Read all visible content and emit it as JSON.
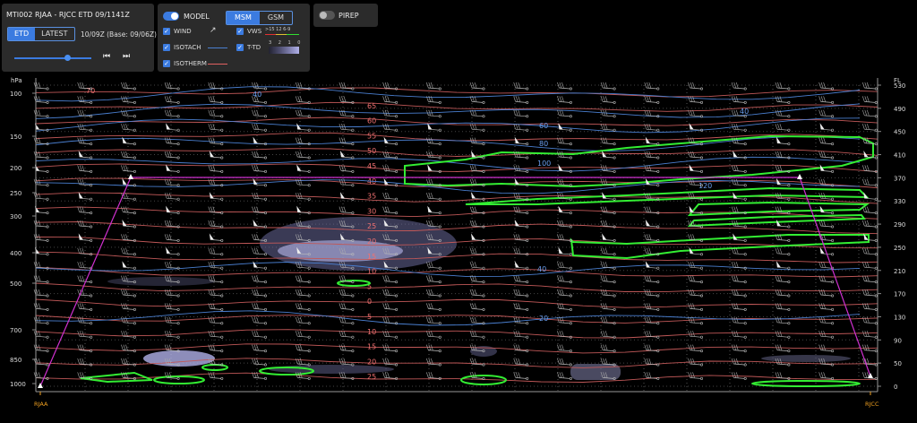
{
  "flight": {
    "route": "MTI002 RJAA - RJCC  ETD 09/1141Z",
    "mode_options": [
      "ETD",
      "LATEST"
    ],
    "mode_selected": "ETD",
    "valid_time": "10/09Z (Base:  09/06Z)",
    "prev_label": "⏮",
    "next_label": "⏭"
  },
  "layers": {
    "model_label": "MODEL",
    "model_options": [
      "MSM",
      "GSM"
    ],
    "model_selected": "MSM",
    "wind_label": "WIND",
    "isotach_label": "ISOTACH",
    "isotherm_label": "ISOTHERM",
    "vws_label": "VWS",
    "ttd_label": "T-TD",
    "vws_scale": ">15  12   6-9",
    "ttd_scale": "3 2 1 0",
    "isotach_color": "#4a7fd0",
    "isotherm_color": "#e06060"
  },
  "pirep": {
    "label": "PIREP"
  },
  "chart": {
    "left_axis_title": "hPa",
    "right_axis_title": "FL",
    "pressure_ticks": [
      "100",
      "150",
      "200",
      "250",
      "300",
      "400",
      "500",
      "700",
      "850",
      "1000"
    ],
    "fl_ticks": [
      "530",
      "490",
      "450",
      "410",
      "370",
      "330",
      "290",
      "250",
      "210",
      "170",
      "130",
      "90",
      "50",
      "0"
    ],
    "departure": "RJAA",
    "arrival": "RJCC",
    "isotherm_labels": [
      "70",
      "65",
      "60",
      "55",
      "50",
      "45",
      "40",
      "35",
      "30",
      "25",
      "20",
      "15",
      "10",
      "5",
      "0",
      "5",
      "10",
      "15",
      "20",
      "25"
    ],
    "isotach_labels": [
      "40",
      "40",
      "60",
      "80",
      "100",
      "120",
      "40",
      "20"
    ],
    "colors": {
      "isotach": "#4a7fd0",
      "isotherm": "#c05858",
      "vws": "#33ee33",
      "route": "#d030d0"
    }
  }
}
